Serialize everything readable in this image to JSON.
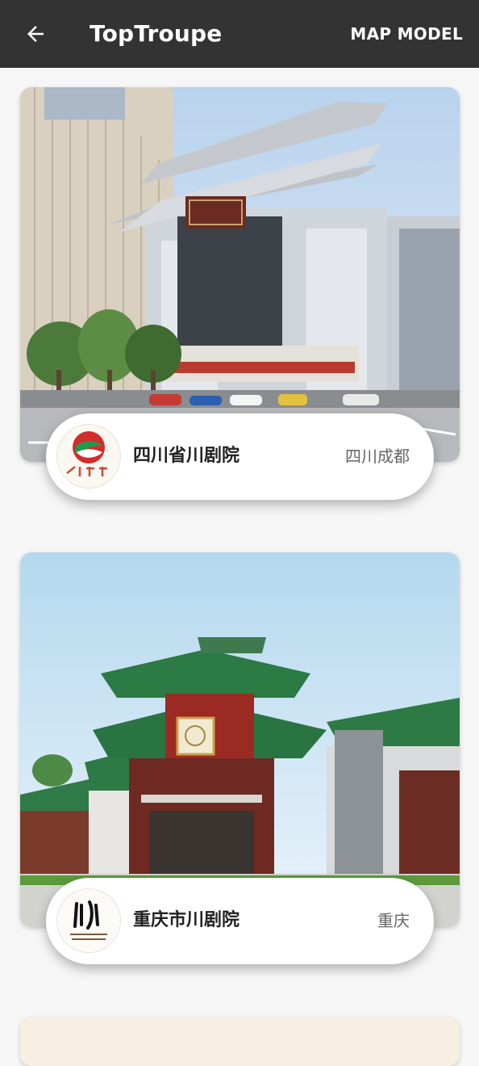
{
  "appbar": {
    "title": "TopTroupe",
    "action_label": "MAP MODEL"
  },
  "troupes": [
    {
      "name": "四川省川剧院",
      "location": "四川成都"
    },
    {
      "name": "重庆市川剧院",
      "location": "重庆"
    }
  ],
  "colors": {
    "appbar_bg": "#333333",
    "page_bg": "#f6f6f6",
    "pill_bg": "#ffffff"
  }
}
